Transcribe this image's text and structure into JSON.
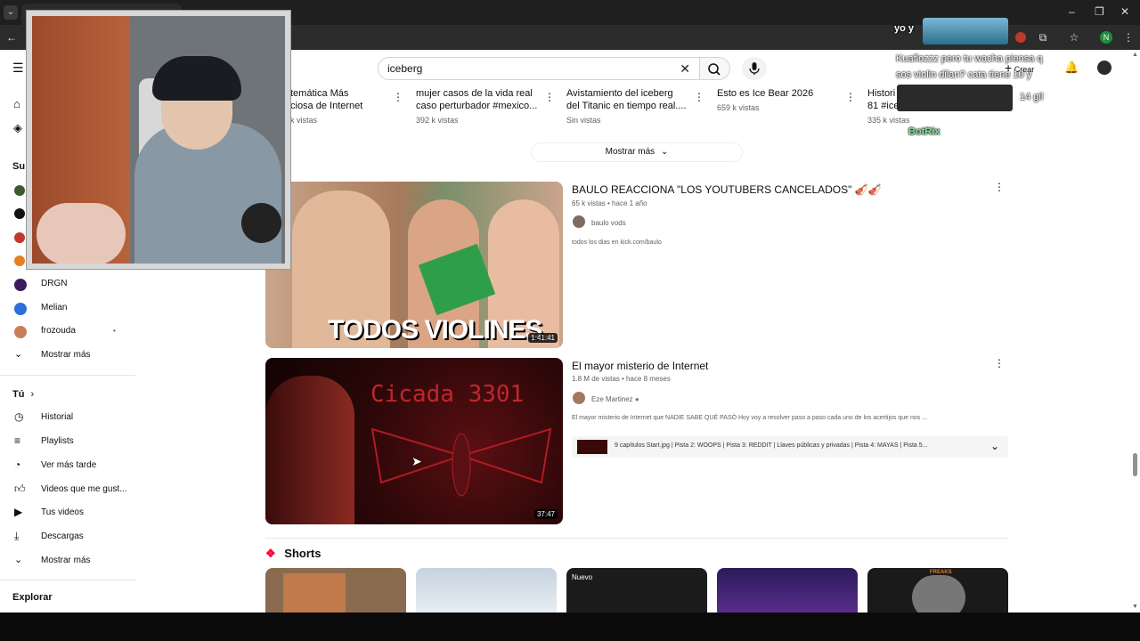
{
  "browser": {
    "window_controls": [
      "–",
      "❐",
      "✕"
    ],
    "profile_initial": "N"
  },
  "search": {
    "value": "iceberg"
  },
  "header": {
    "create_label": "Crear"
  },
  "top_strip": [
    {
      "title": "temática Más\nciosa de Internet",
      "meta": "k vistas"
    },
    {
      "title": "mujer casos de la vida real\ncaso perturbador #mexico...",
      "meta": "392 k vistas"
    },
    {
      "title": "Avistamiento del iceberg\ndel Titanic en tiempo real....",
      "meta": "Sin vistas"
    },
    {
      "title": "Esto es Ice Bear 2026",
      "meta": "659 k vistas"
    },
    {
      "title": "Histori\n81 #ice",
      "meta": "335 k vistas"
    }
  ],
  "show_more_label": "Mostrar más",
  "sidebar": {
    "section_subs_prefix": "Su",
    "subscriptions": [
      {
        "name": "DRGN",
        "color": "#3b1b5e"
      },
      {
        "name": "Melian",
        "color": "#2c6fd8"
      },
      {
        "name": "frozouda",
        "color": "#c77f5a"
      }
    ],
    "subs_more": "Mostrar más",
    "you_title": "Tú",
    "you_items": [
      {
        "label": "Historial",
        "icon": "history-icon"
      },
      {
        "label": "Playlists",
        "icon": "playlists-icon"
      },
      {
        "label": "Ver más tarde",
        "icon": "watch-later-icon"
      },
      {
        "label": "Videos que me gust...",
        "icon": "like-icon"
      },
      {
        "label": "Tus videos",
        "icon": "your-videos-icon"
      },
      {
        "label": "Descargas",
        "icon": "download-icon"
      }
    ],
    "you_more": "Mostrar más",
    "explore_title": "Explorar"
  },
  "videos": [
    {
      "title": "BAULO REACCIONA \"LOS YOUTUBERS CANCELADOS\" 🎻🎻",
      "meta": "65 k vistas • hace 1 año",
      "channel": "baulo vods",
      "description": "todos los dias en kick.com/baulo",
      "duration": "1:41:41",
      "thumb_text": "TODOS VIOLINES"
    },
    {
      "title": "El mayor misterio de Internet",
      "meta": "1.8 M de vistas • hace 8 meses",
      "channel": "Eze Martinez",
      "description": "El mayor misterio de Internet que NADIE SABE QUÉ PASÓ Hoy voy a resolver paso a paso cada uno de los acertijos que nos ...",
      "chapters": "9 capítulos  Start.jpg | Pista 2: WOOPS | Pista 3: REDDIT | Llaves públicas y privadas | Pista 4: MAYAS | Pista 5...",
      "duration": "37:47",
      "thumb_text": "Cicada 3301"
    }
  ],
  "shorts": {
    "title": "Shorts",
    "badges": [
      "",
      "",
      "Nuevo",
      "",
      "FREAKS"
    ]
  },
  "stream_overlay": {
    "chat_top": "yo y",
    "chat_line1": "Kuaflozzz pero tu wacha piensa q",
    "chat_line2": "sos violin dilan? cata tiene 10 y",
    "chat_line3": "14 gil",
    "chat_user": "BotRix"
  }
}
